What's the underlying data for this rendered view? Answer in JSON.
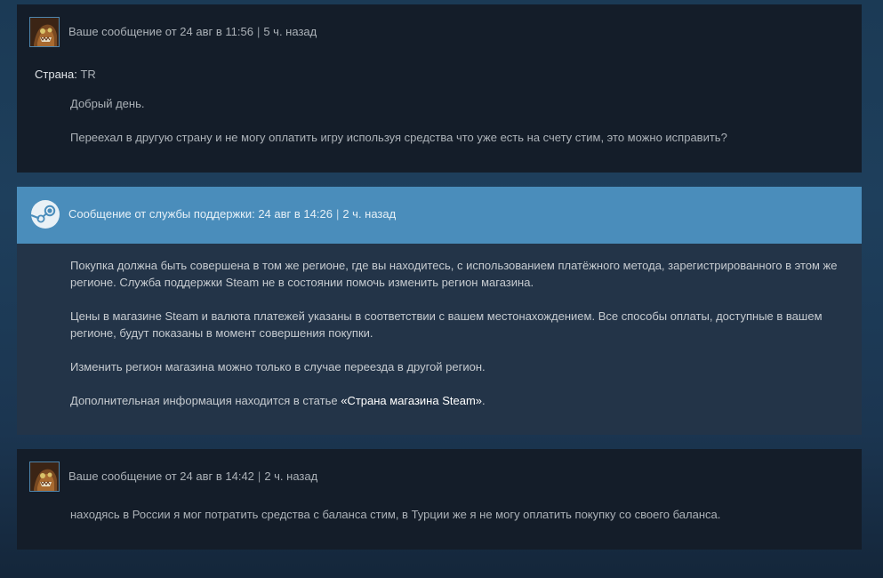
{
  "messages": [
    {
      "author": "Ваше сообщение от 24 авг в 11:56",
      "ago": "5 ч. назад",
      "country_label": "Страна:",
      "country_value": "TR",
      "paragraphs": [
        "Добрый день.",
        "Переехал в другую страну и не могу оплатить игру используя средства что уже есть на счету стим, это можно исправить?"
      ]
    },
    {
      "author": "Сообщение от службы поддержки: 24 авг в 14:26",
      "ago": "2 ч. назад",
      "paragraphs": [
        "Покупка должна быть совершена в том же регионе, где вы находитесь, с использованием платёжного метода, зарегистрированного в этом же регионе. Служба поддержки Steam не в состоянии помочь изменить регион магазина.",
        "Цены в магазине Steam и валюта платежей указаны в соответствии с вашем местонахождением. Все способы оплаты, доступные в вашем регионе, будут показаны в момент совершения покупки.",
        "Изменить регион магазина можно только в случае переезда в другой регион."
      ],
      "link_prefix": "Дополнительная информация находится в статье ",
      "link_text": "«Страна магазина Steam»",
      "link_suffix": "."
    },
    {
      "author": "Ваше сообщение от 24 авг в 14:42",
      "ago": "2 ч. назад",
      "paragraphs": [
        "находясь в России я мог потратить средства с баланса стим, в Турции же я не могу оплатить покупку со своего баланса."
      ]
    }
  ],
  "separator": "|",
  "icons": {
    "user_avatar": "user-avatar-icon",
    "support_logo": "steam-logo-icon"
  },
  "colors": {
    "support_header": "#4a8dbb",
    "user_card": "#141d29",
    "support_card": "#233448",
    "link": "#ffffff"
  }
}
